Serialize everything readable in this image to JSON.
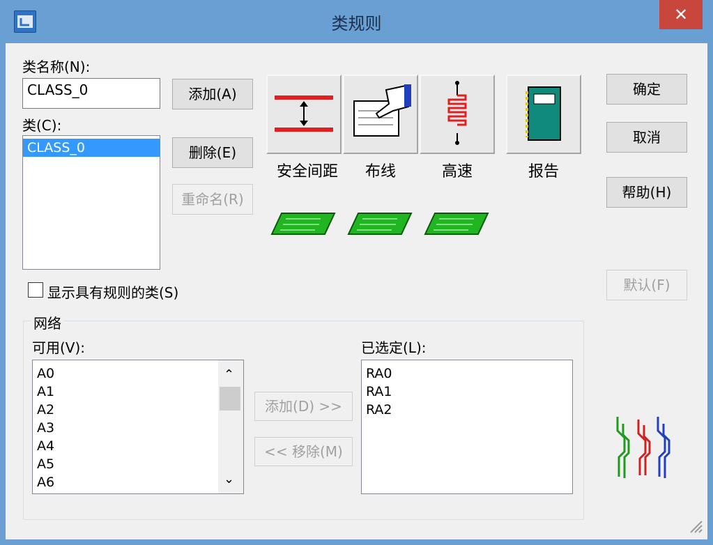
{
  "window": {
    "title": "类规则",
    "close_glyph": "✕"
  },
  "class_name": {
    "label": "类名称(N):",
    "value": "CLASS_0"
  },
  "buttons": {
    "add": "添加(A)",
    "delete": "删除(E)",
    "rename": "重命名(R)",
    "ok": "确定",
    "cancel": "取消",
    "help": "帮助(H)",
    "default": "默认(F)"
  },
  "classes": {
    "label": "类(C):",
    "items": [
      "CLASS_0"
    ],
    "selected": "CLASS_0"
  },
  "rule_icons": {
    "clearance": "安全间距",
    "routing": "布线",
    "high_speed": "高速",
    "report": "报告"
  },
  "show_rules_checkbox": {
    "label": "显示具有规则的类(S)",
    "checked": false
  },
  "nets": {
    "group_label": "网络",
    "available": {
      "label": "可用(V):",
      "items": [
        "A0",
        "A1",
        "A2",
        "A3",
        "A4",
        "A5",
        "A6"
      ]
    },
    "selected": {
      "label": "已选定(L):",
      "items": [
        "RA0",
        "RA1",
        "RA2"
      ]
    },
    "add_btn": "添加(D) >>",
    "remove_btn": "<< 移除(M)"
  },
  "colors": {
    "title_bar": "#6a9fd4",
    "close_red": "#c9463d",
    "selection": "#3399ff"
  }
}
